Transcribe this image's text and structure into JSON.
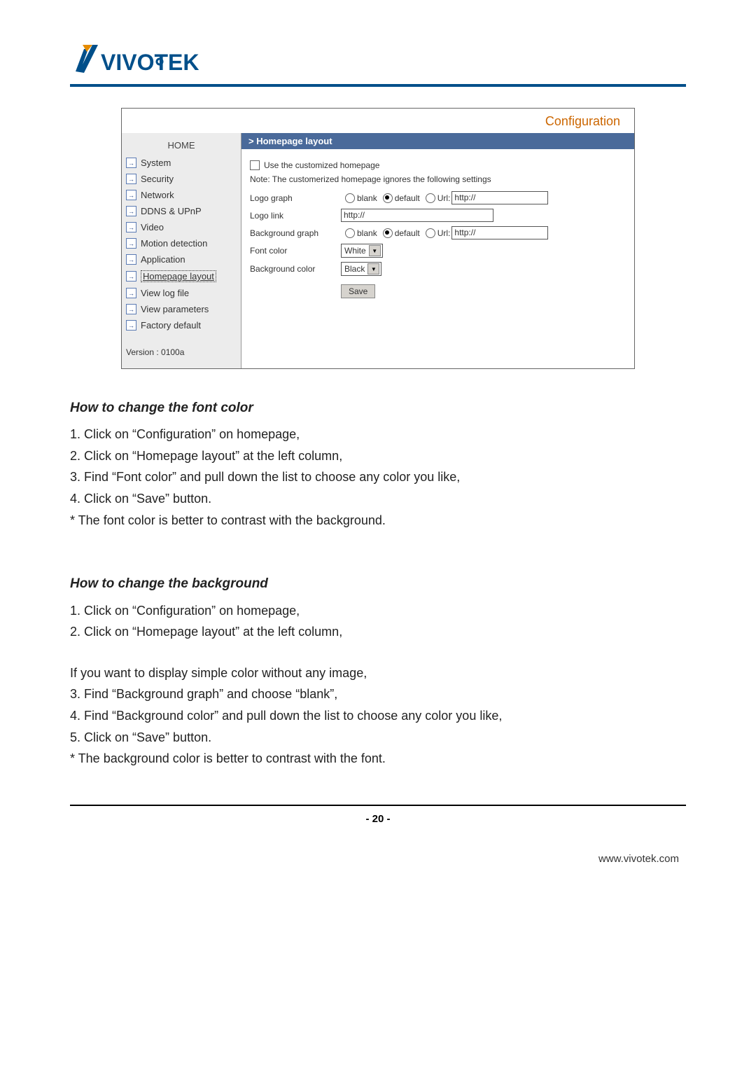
{
  "logo": {
    "text": "VIVOTEK"
  },
  "config": {
    "title": "Configuration",
    "panel_header": "> Homepage layout",
    "sidebar": {
      "home": "HOME",
      "items": [
        {
          "label": "System"
        },
        {
          "label": "Security"
        },
        {
          "label": "Network"
        },
        {
          "label": "DDNS & UPnP"
        },
        {
          "label": "Video"
        },
        {
          "label": "Motion detection"
        },
        {
          "label": "Application"
        },
        {
          "label": "Homepage layout",
          "active": true
        },
        {
          "label": "View log file"
        },
        {
          "label": "View parameters"
        },
        {
          "label": "Factory default"
        }
      ],
      "version": "Version : 0100a"
    },
    "form": {
      "use_custom_label": "Use the customized homepage",
      "note": "Note: The customerized homepage ignores the following settings",
      "logo_graph": {
        "label": "Logo graph",
        "blank": "blank",
        "default": "default",
        "url_label": "Url:",
        "url_value": "http://"
      },
      "logo_link": {
        "label": "Logo link",
        "value": "http://"
      },
      "bg_graph": {
        "label": "Background graph",
        "blank": "blank",
        "default": "default",
        "url_label": "Url:",
        "url_value": "http://"
      },
      "font_color": {
        "label": "Font color",
        "value": "White"
      },
      "bg_color": {
        "label": "Background color",
        "value": "Black"
      },
      "save": "Save"
    }
  },
  "doc": {
    "section1_title": "How to change the font color",
    "section1_lines": [
      "1. Click on “Configuration” on homepage,",
      "2. Click on “Homepage layout” at the left column,",
      "3. Find “Font color” and pull down the list to choose any color you like,",
      "4. Click on “Save” button.",
      "* The font color is better to contrast with the background."
    ],
    "section2_title": "How to change the background",
    "section2_lines_a": [
      "1. Click on “Configuration” on homepage,",
      "2. Click on “Homepage layout” at the left column,"
    ],
    "section2_mid": "If you want to display simple color without any image,",
    "section2_lines_b": [
      "3. Find “Background graph” and choose “blank”,",
      "4. Find “Background color” and pull down the list to choose any color you like,",
      "5. Click on “Save” button.",
      "* The background color is better to contrast with the font."
    ]
  },
  "page_number": "- 20 -",
  "footer_url": "www.vivotek.com"
}
